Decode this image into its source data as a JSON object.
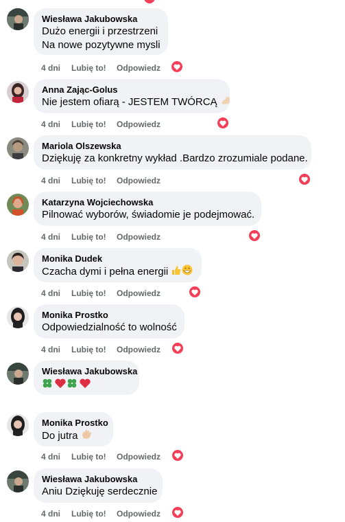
{
  "actions": {
    "time": "4 dni",
    "like": "Lubię to!",
    "reply": "Odpowiedz"
  },
  "colors": {
    "bubble": "#f0f2f5",
    "heart": "#f33e58",
    "meta": "#65676b"
  },
  "comments": [
    {
      "author": "Wiesława Jakubowska",
      "lines": [
        "Dużo energii i przestrzeni",
        "Na nowe pozytywne mysli"
      ]
    },
    {
      "author": "Anna Zając-Golus",
      "lines": [
        "Nie jestem ofiarą - JESTEM TWÓRCĄ"
      ],
      "emoji": "flexed-biceps-emoji"
    },
    {
      "author": "Mariola Olszewska",
      "lines": [
        "Dziękuję za konkretny wykład .Bardzo zrozumiale podane."
      ]
    },
    {
      "author": "Katarzyna Wojciechowska",
      "lines": [
        "Pilnować wyborów, świadomie je podejmować."
      ]
    },
    {
      "author": "Monika Dudek",
      "lines": [
        "Czacha dymi i pełna energii"
      ],
      "emoji": "thumbs-up-and-grin-emoji"
    },
    {
      "author": "Monika Prostko",
      "lines": [
        "Odpowiedzialność to wolność"
      ]
    },
    {
      "author": "Wiesława Jakubowska",
      "lines": [
        ""
      ],
      "emoji": "clover-heart-clover-heart-emoji"
    },
    {
      "author": "Monika Prostko",
      "lines": [
        "Do jutra"
      ],
      "emoji": "waving-hand-emoji"
    },
    {
      "author": "Wiesława Jakubowska",
      "lines": [
        "Aniu Dziękuję serdecznie"
      ]
    }
  ]
}
